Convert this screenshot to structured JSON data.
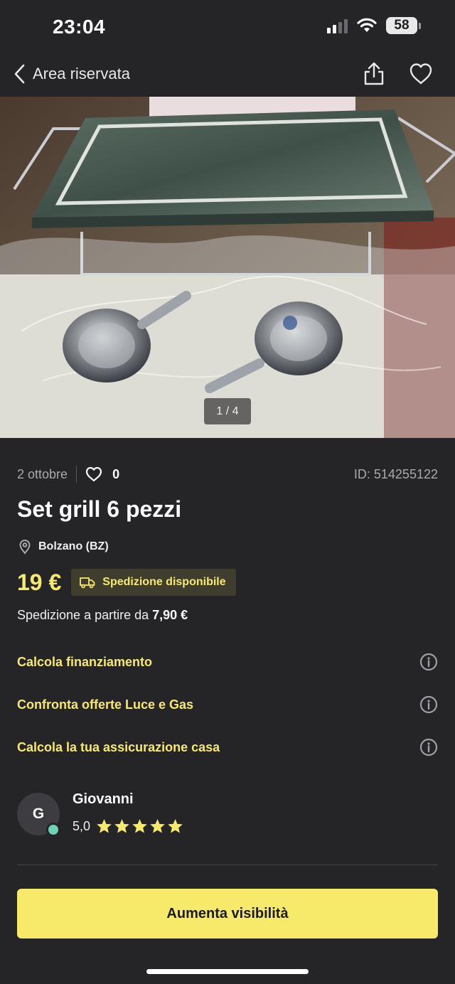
{
  "status_bar": {
    "time": "23:04",
    "battery": "58",
    "icons": [
      "signal-icon",
      "wifi-icon",
      "battery-icon"
    ]
  },
  "nav": {
    "back_label": "Area riservata",
    "icons": [
      "chevron-left-icon",
      "share-icon",
      "heart-icon"
    ]
  },
  "gallery": {
    "counter": "1 / 4"
  },
  "listing": {
    "date": "2 ottobre",
    "likes": "0",
    "id": "ID: 514255122",
    "title": "Set grill 6 pezzi",
    "location": "Bolzano (BZ)",
    "price": "19 €",
    "shipping_badge": "Spedizione disponibile",
    "shipping_note_prefix": "Spedizione a partire da ",
    "shipping_note_price": "7,90 €"
  },
  "services": [
    {
      "label": "Calcola finanziamento"
    },
    {
      "label": "Confronta offerte Luce e Gas"
    },
    {
      "label": "Calcola la tua assicurazione casa"
    }
  ],
  "seller": {
    "initial": "G",
    "name": "Giovanni",
    "rating": "5,0",
    "stars": 5,
    "online": true
  },
  "cta": {
    "label": "Aumenta visibilità"
  },
  "colors": {
    "background": "#252528",
    "accent": "#f7e96a",
    "muted_text": "#a9a9ad",
    "online": "#6fd1b7"
  }
}
